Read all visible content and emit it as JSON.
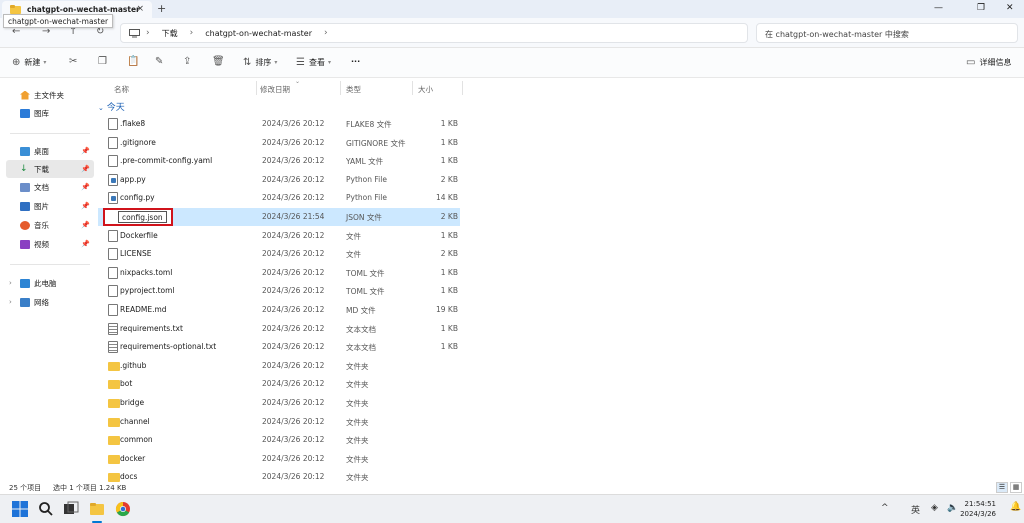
{
  "window": {
    "tab_title": "chatgpt-on-wechat-master",
    "tooltip": "chatgpt-on-wechat-master",
    "close_glyph": "×",
    "newtab_glyph": "+",
    "minimize_glyph": "—",
    "maximize_glyph": "❐",
    "closewin_glyph": "✕"
  },
  "nav": {
    "back": "←",
    "forward": "→",
    "up": "↑",
    "refresh": "↻",
    "breadcrumb": [
      "下载",
      "chatgpt-on-wechat-master"
    ],
    "search_placeholder": "在 chatgpt-on-wechat-master 中搜索"
  },
  "toolbar": {
    "new_label": "新建",
    "sort_label": "排序",
    "view_label": "查看",
    "more_label": "···",
    "details_label": "详细信息"
  },
  "sidebar": {
    "items": [
      {
        "label": "主文件夹",
        "icon": "home-icon"
      },
      {
        "label": "图库",
        "icon": "gallery-icon"
      },
      {
        "label": "桌面",
        "icon": "desktop-icon"
      },
      {
        "label": "下载",
        "icon": "download-icon"
      },
      {
        "label": "文档",
        "icon": "documents-icon"
      },
      {
        "label": "图片",
        "icon": "pictures-icon"
      },
      {
        "label": "音乐",
        "icon": "music-icon"
      },
      {
        "label": "视频",
        "icon": "videos-icon"
      },
      {
        "label": "此电脑",
        "icon": "pc-icon"
      },
      {
        "label": "网络",
        "icon": "network-icon"
      }
    ]
  },
  "columns": {
    "name": "名称",
    "date": "修改日期",
    "type": "类型",
    "size": "大小"
  },
  "group_label": "今天",
  "files": [
    {
      "name": ".flake8",
      "date": "2024/3/26 20:12",
      "type": "FLAKE8 文件",
      "size": "1 KB",
      "kind": "doc"
    },
    {
      "name": ".gitignore",
      "date": "2024/3/26 20:12",
      "type": "GITIGNORE 文件",
      "size": "1 KB",
      "kind": "doc"
    },
    {
      "name": ".pre-commit-config.yaml",
      "date": "2024/3/26 20:12",
      "type": "YAML 文件",
      "size": "1 KB",
      "kind": "doc"
    },
    {
      "name": "app.py",
      "date": "2024/3/26 20:12",
      "type": "Python File",
      "size": "2 KB",
      "kind": "py"
    },
    {
      "name": "config.py",
      "date": "2024/3/26 20:12",
      "type": "Python File",
      "size": "14 KB",
      "kind": "py"
    },
    {
      "name": "config.json",
      "date": "2024/3/26 21:54",
      "type": "JSON 文件",
      "size": "2 KB",
      "kind": "doc"
    },
    {
      "name": "Dockerfile",
      "date": "2024/3/26 20:12",
      "type": "文件",
      "size": "1 KB",
      "kind": "doc"
    },
    {
      "name": "LICENSE",
      "date": "2024/3/26 20:12",
      "type": "文件",
      "size": "2 KB",
      "kind": "doc"
    },
    {
      "name": "nixpacks.toml",
      "date": "2024/3/26 20:12",
      "type": "TOML 文件",
      "size": "1 KB",
      "kind": "doc"
    },
    {
      "name": "pyproject.toml",
      "date": "2024/3/26 20:12",
      "type": "TOML 文件",
      "size": "1 KB",
      "kind": "doc"
    },
    {
      "name": "README.md",
      "date": "2024/3/26 20:12",
      "type": "MD 文件",
      "size": "19 KB",
      "kind": "doc"
    },
    {
      "name": "requirements.txt",
      "date": "2024/3/26 20:12",
      "type": "文本文档",
      "size": "1 KB",
      "kind": "txt"
    },
    {
      "name": "requirements-optional.txt",
      "date": "2024/3/26 20:12",
      "type": "文本文档",
      "size": "1 KB",
      "kind": "txt"
    },
    {
      "name": ".github",
      "date": "2024/3/26 20:12",
      "type": "文件夹",
      "size": "",
      "kind": "folder"
    },
    {
      "name": "bot",
      "date": "2024/3/26 20:12",
      "type": "文件夹",
      "size": "",
      "kind": "folder"
    },
    {
      "name": "bridge",
      "date": "2024/3/26 20:12",
      "type": "文件夹",
      "size": "",
      "kind": "folder"
    },
    {
      "name": "channel",
      "date": "2024/3/26 20:12",
      "type": "文件夹",
      "size": "",
      "kind": "folder"
    },
    {
      "name": "common",
      "date": "2024/3/26 20:12",
      "type": "文件夹",
      "size": "",
      "kind": "folder"
    },
    {
      "name": "docker",
      "date": "2024/3/26 20:12",
      "type": "文件夹",
      "size": "",
      "kind": "folder"
    },
    {
      "name": "docs",
      "date": "2024/3/26 20:12",
      "type": "文件夹",
      "size": "",
      "kind": "folder"
    }
  ],
  "selected_index": 5,
  "status": {
    "count": "25 个项目",
    "selected": "选中 1 个项目  1.24 KB"
  },
  "tray": {
    "ime": "英",
    "chevron": "^",
    "time": "21:54:51",
    "date": "2024/3/26"
  },
  "colors": {
    "accent": "#0078d4",
    "selection": "#cce8ff",
    "highlight_box": "#d0131b",
    "folder": "#f4c542"
  }
}
